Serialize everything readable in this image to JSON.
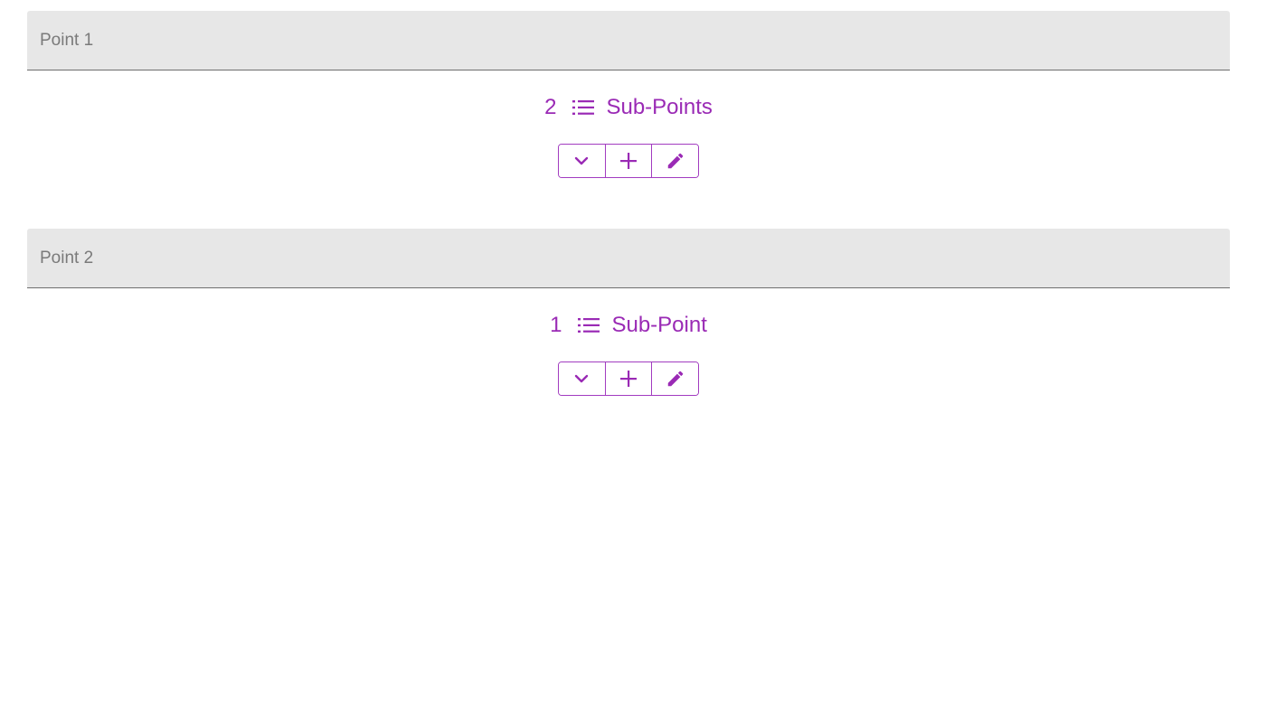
{
  "accent_color": "#9a2ab5",
  "points": [
    {
      "title": "Point 1",
      "sub_count": "2",
      "sub_label": "Sub-Points",
      "icons": {
        "list": "list-icon",
        "expand": "chevron-down-icon",
        "add": "plus-icon",
        "edit": "pencil-icon"
      }
    },
    {
      "title": "Point 2",
      "sub_count": "1",
      "sub_label": "Sub-Point",
      "icons": {
        "list": "list-icon",
        "expand": "chevron-down-icon",
        "add": "plus-icon",
        "edit": "pencil-icon"
      }
    }
  ]
}
